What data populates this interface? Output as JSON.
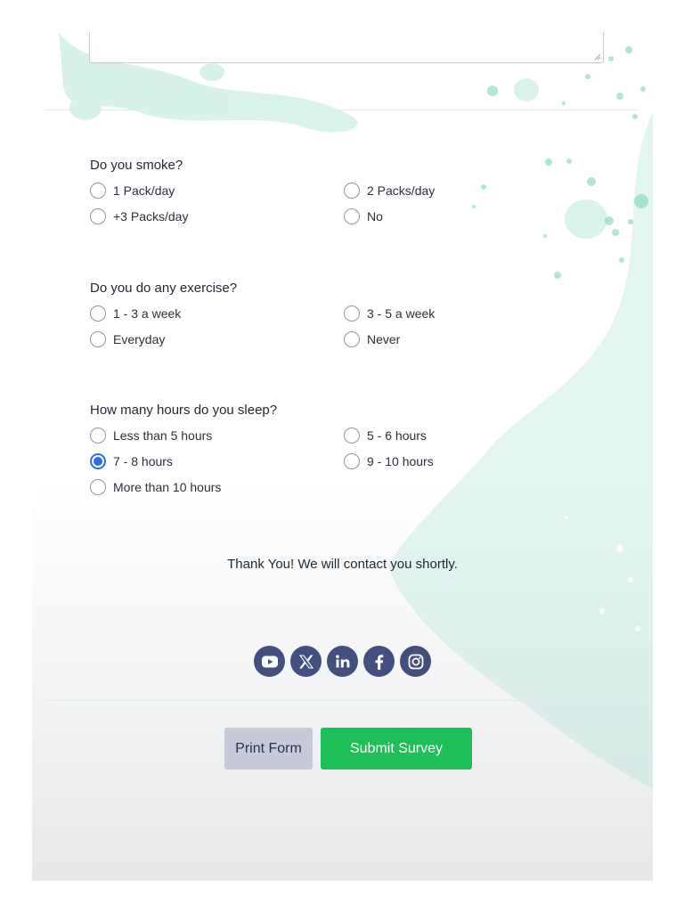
{
  "questions": [
    {
      "label": "Do you smoke?",
      "options": [
        {
          "label": "1 Pack/day",
          "checked": false
        },
        {
          "label": "2 Packs/day",
          "checked": false
        },
        {
          "label": "+3 Packs/day",
          "checked": false
        },
        {
          "label": "No",
          "checked": false
        }
      ]
    },
    {
      "label": "Do you do any exercise?",
      "options": [
        {
          "label": "1 - 3 a week",
          "checked": false
        },
        {
          "label": "3 - 5 a week",
          "checked": false
        },
        {
          "label": "Everyday",
          "checked": false
        },
        {
          "label": "Never",
          "checked": false
        }
      ]
    },
    {
      "label": "How many hours do you sleep?",
      "options": [
        {
          "label": "Less than 5 hours",
          "checked": false
        },
        {
          "label": "5 - 6 hours",
          "checked": false
        },
        {
          "label": "7 - 8 hours",
          "checked": true
        },
        {
          "label": "9 - 10 hours",
          "checked": false
        },
        {
          "label": "More than 10 hours",
          "checked": false
        }
      ]
    }
  ],
  "thanks_message": "Thank You! We will contact you shortly.",
  "social_icons": [
    "youtube-icon",
    "x-icon",
    "linkedin-icon",
    "facebook-icon",
    "instagram-icon"
  ],
  "buttons": {
    "print_label": "Print Form",
    "submit_label": "Submit Survey"
  },
  "colors": {
    "accent_green": "#1fbf5a",
    "radio_selected": "#2b6de8",
    "social_bg": "#434f7f",
    "print_bg": "#c7cbd9",
    "splash": "#7fd8bd"
  }
}
